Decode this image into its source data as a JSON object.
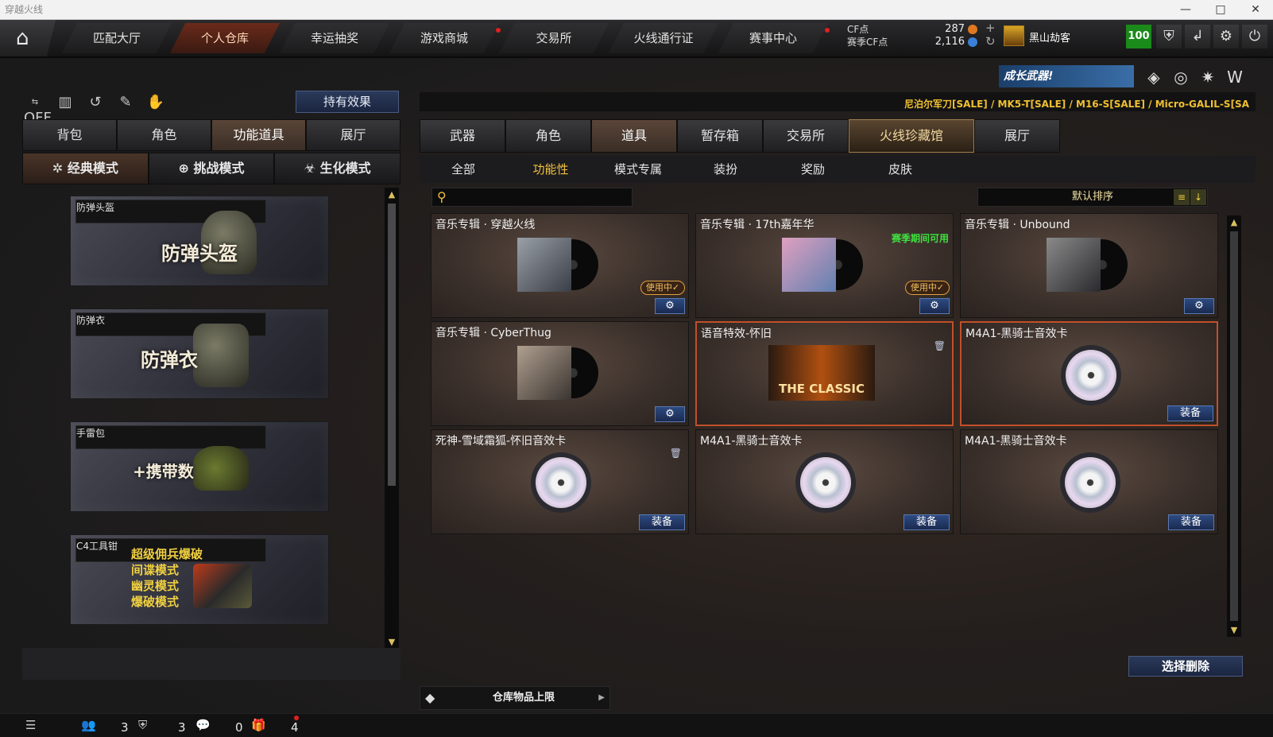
{
  "window": {
    "title": "穿越火线",
    "min": "—",
    "max": "□",
    "close": "✕"
  },
  "nav": {
    "tabs": [
      "匹配大厅",
      "个人仓库",
      "幸运抽奖",
      "游戏商城",
      "交易所",
      "火线通行证",
      "赛事中心"
    ]
  },
  "currency": {
    "cf_label": "CF点",
    "cf_value": "287",
    "season_label": "赛季CF点",
    "season_value": "2,116",
    "plus": "+",
    "refresh": "↻"
  },
  "user": {
    "name": "黑山劫客",
    "level": "100"
  },
  "left": {
    "hold_effect": "持有效果",
    "off": "OFF",
    "tabs": [
      "背包",
      "角色",
      "功能道具",
      "展厅"
    ],
    "modes": [
      "经典模式",
      "挑战模式",
      "生化模式"
    ],
    "items": [
      {
        "cap": "防弹头盔",
        "big": "防弹头盔"
      },
      {
        "cap": "防弹衣",
        "big": "防弹衣"
      },
      {
        "cap": "手雷包",
        "big": "+携带数"
      },
      {
        "cap": "C4工具钳",
        "lines": [
          "超级佣兵爆破",
          "间谍模式",
          "幽灵模式",
          "爆破模式"
        ]
      }
    ]
  },
  "promo": {
    "text": "成长武器!"
  },
  "sale_ticker": "尼泊尔军刀[SALE] / MK5-T[SALE] / M16-S[SALE] / Micro-GALIL-S[SA",
  "right": {
    "tabs": [
      "武器",
      "角色",
      "道具",
      "暂存箱",
      "交易所",
      "火线珍藏馆",
      "展厅"
    ],
    "subtabs": [
      "全部",
      "功能性",
      "模式专属",
      "装扮",
      "奖励",
      "皮肤"
    ],
    "sort_label": "默认排序",
    "cards": [
      {
        "title": "音乐专辑 · 穿越火线",
        "inuse": "使用中✓"
      },
      {
        "title": "音乐专辑 · 17th嘉年华",
        "inuse": "使用中✓",
        "note": "赛季期间可用"
      },
      {
        "title": "音乐专辑 · Unbound"
      },
      {
        "title": "音乐专辑 · CyberThug"
      },
      {
        "title": "语音特效-怀旧",
        "cover_text": "THE CLASSIC"
      },
      {
        "title": "M4A1-黑骑士音效卡",
        "equip": "装备"
      },
      {
        "title": "死神-雪域霜狐-怀旧音效卡",
        "equip": "装备"
      },
      {
        "title": "M4A1-黑骑士音效卡",
        "equip": "装备"
      },
      {
        "title": "M4A1-黑骑士音效卡",
        "equip": "装备"
      }
    ],
    "delete_btn": "选择删除",
    "capacity": "仓库物品上限"
  },
  "footer": {
    "counts": [
      "3",
      "3",
      "0",
      "4"
    ]
  }
}
